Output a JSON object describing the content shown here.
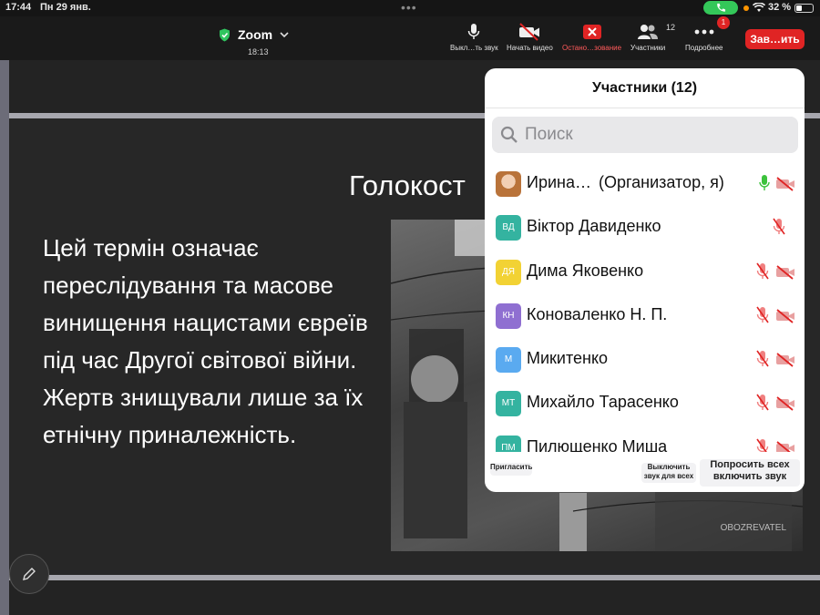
{
  "status": {
    "time": "17:44",
    "date": "Пн 29 янв.",
    "dots": "•••",
    "battery": "32 %"
  },
  "toolbar": {
    "app_title": "Zoom",
    "elapsed": "18:13",
    "mute_label": "Выкл…ть звук",
    "video_label": "Начать видео",
    "stop_share_label": "Остано…зование",
    "participants_label": "Участники",
    "participants_count": "12",
    "more_label": "Подробнее",
    "more_badge": "1",
    "end_label": "Зав…ить"
  },
  "slide": {
    "title": "Голокост",
    "body": "Цей термін означає переслідування та масове винищення нацистами євреїв під час Другої світової війни. Жертв знищували лише за їх етнічну приналежність.",
    "photo_watermark": "OBOZREVATEL"
  },
  "panel": {
    "title": "Участники (12)",
    "search_placeholder": "Поиск",
    "participants": [
      {
        "initials": "",
        "name": "Ирина…",
        "role": "(Организатор, я)",
        "avatar_color": "#b9733a",
        "mic": "on",
        "cam": "off"
      },
      {
        "initials": "ВД",
        "name": "Віктор Давиденко",
        "role": "",
        "avatar_color": "#34b3a0",
        "mic": "off",
        "cam": "none"
      },
      {
        "initials": "ДЯ",
        "name": "Дима Яковенко",
        "role": "",
        "avatar_color": "#f2d234",
        "mic": "off",
        "cam": "off"
      },
      {
        "initials": "КН",
        "name": "Коноваленко Н. П.",
        "role": "",
        "avatar_color": "#8f6fd1",
        "mic": "off",
        "cam": "off"
      },
      {
        "initials": "М",
        "name": "Микитенко",
        "role": "",
        "avatar_color": "#5aaaf0",
        "mic": "off",
        "cam": "off"
      },
      {
        "initials": "МТ",
        "name": "Михайло Тарасенко",
        "role": "",
        "avatar_color": "#34b3a0",
        "mic": "off",
        "cam": "off"
      },
      {
        "initials": "ПМ",
        "name": "Пилющенко Миша",
        "role": "",
        "avatar_color": "#34b3a0",
        "mic": "off",
        "cam": "off"
      }
    ],
    "invite_label": "Пригласить",
    "mute_all_label": "Выключить звук для всех",
    "ask_unmute_label": "Попросить всех включить звук"
  },
  "colors": {
    "accent_red": "#e02424",
    "mic_on": "#3cc23c",
    "shield": "#2fc45e"
  }
}
